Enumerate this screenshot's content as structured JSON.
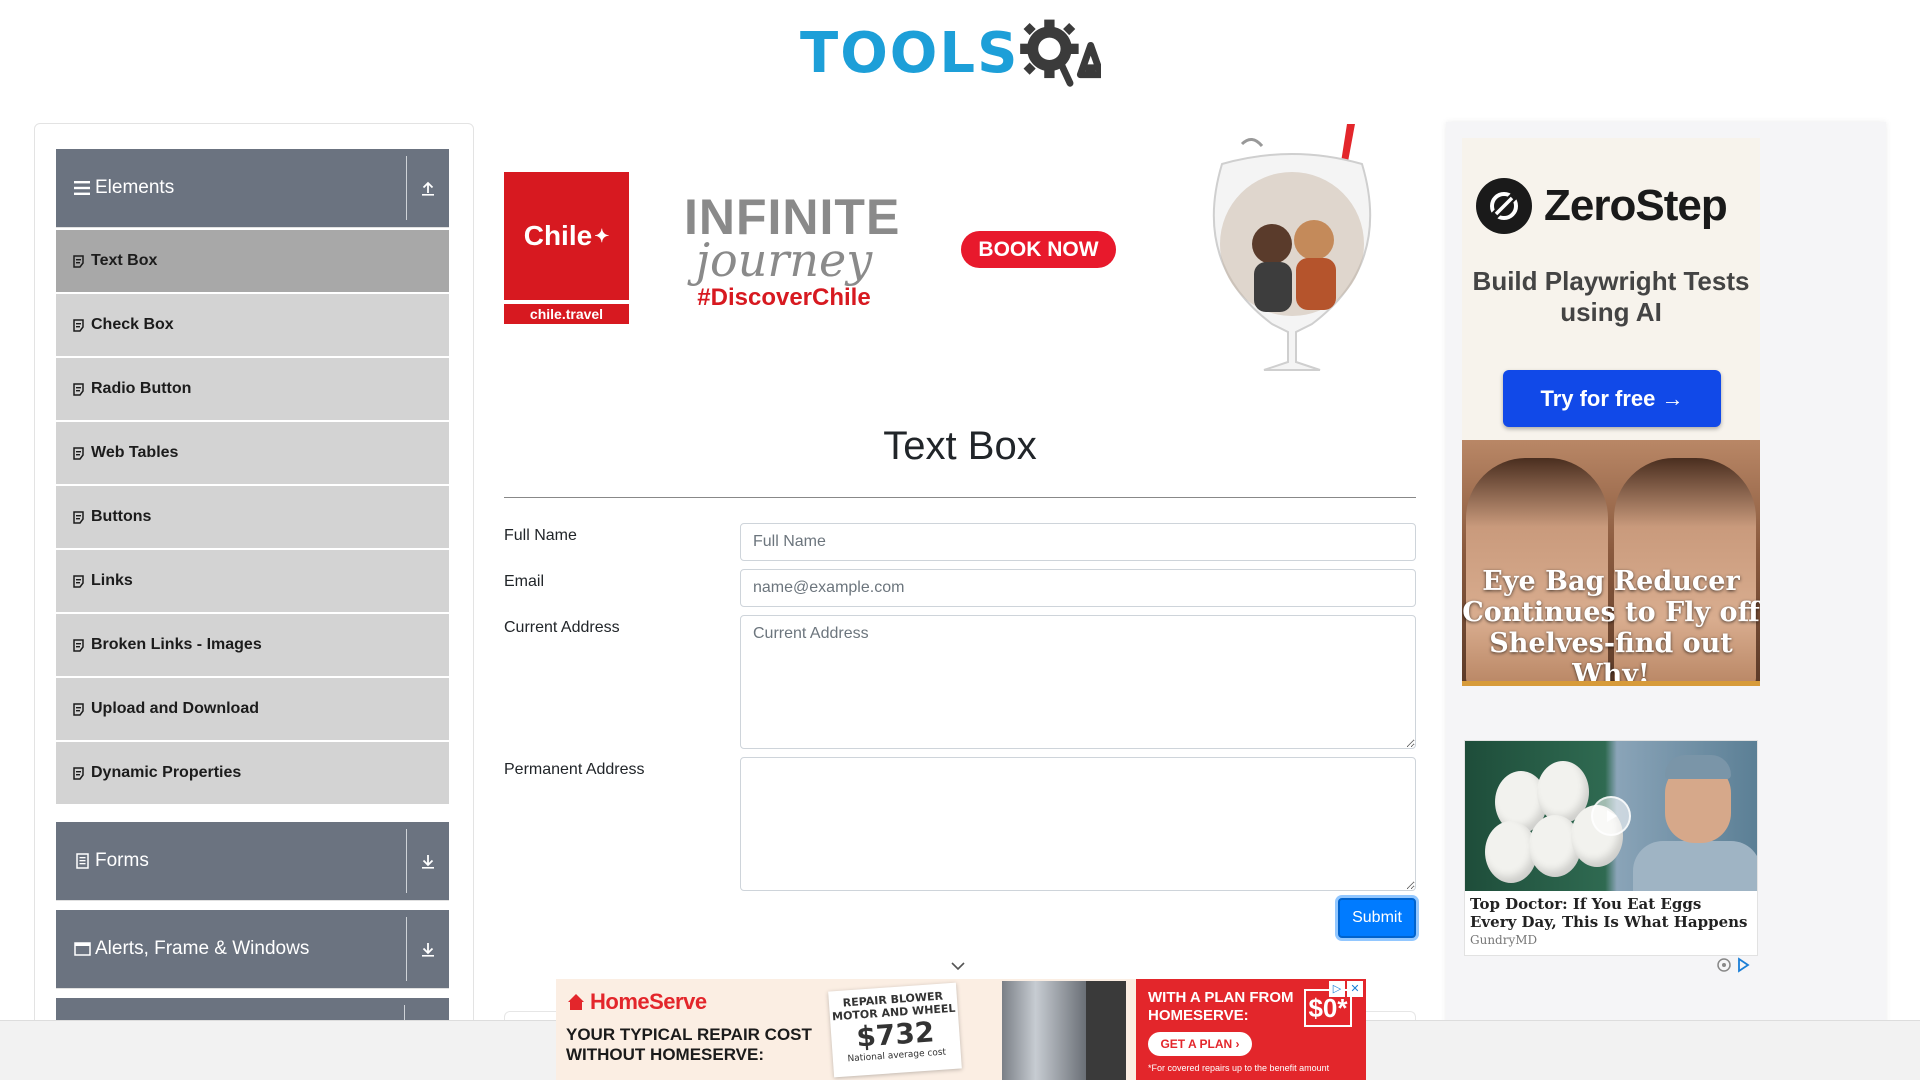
{
  "header": {
    "logo_text": "TOOLS",
    "logo_suffix": "QA"
  },
  "sidebar": {
    "groups": [
      {
        "title": "Elements",
        "icon": "hamburger-icon",
        "arrow": "upload-arrow-icon"
      },
      {
        "title": "Forms",
        "icon": "form-icon",
        "arrow": "download-arrow-icon"
      },
      {
        "title": "Alerts, Frame & Windows",
        "icon": "window-icon",
        "arrow": "download-arrow-icon"
      }
    ],
    "items": [
      {
        "label": "Text Box",
        "active": true
      },
      {
        "label": "Check Box"
      },
      {
        "label": "Radio Button"
      },
      {
        "label": "Web Tables"
      },
      {
        "label": "Buttons"
      },
      {
        "label": "Links"
      },
      {
        "label": "Broken Links - Images"
      },
      {
        "label": "Upload and Download"
      },
      {
        "label": "Dynamic Properties"
      }
    ]
  },
  "top_ad": {
    "chile_logo": "Chile",
    "chile_site": "chile.travel",
    "line1": "INFINITE",
    "line2": "journey",
    "hashtag": "#DiscoverChile",
    "cta": "BOOK NOW"
  },
  "main": {
    "title": "Text Box",
    "fields": {
      "full_name": {
        "label": "Full Name",
        "placeholder": "Full Name",
        "value": ""
      },
      "email": {
        "label": "Email",
        "placeholder": "name@example.com",
        "value": ""
      },
      "current_address": {
        "label": "Current Address",
        "placeholder": "Current Address",
        "value": ""
      },
      "permanent_address": {
        "label": "Permanent Address",
        "placeholder": "",
        "value": ""
      }
    },
    "submit_label": "Submit"
  },
  "right_ads": {
    "zerostep": {
      "name": "ZeroStep",
      "tagline": "Build Playwright Tests using AI",
      "cta": "Try for free →"
    },
    "eyebag": {
      "headline": "Eye Bag Reducer Continues to Fly off Shelves-find out Why!"
    },
    "eggs": {
      "title": "Top Doctor: If You Eat Eggs Every Day, This Is What Happens",
      "source": "GundryMD"
    }
  },
  "bottom_ad": {
    "brand": "HomeServe",
    "headline": "YOUR TYPICAL REPAIR COST WITHOUT HOMESERVE:",
    "card_title": "REPAIR BLOWER MOTOR AND WHEEL",
    "card_price": "$732",
    "card_note": "National average cost",
    "red_text": "WITH A PLAN FROM HOMESERVE:",
    "red_price": "$0*",
    "red_cta": "GET A PLAN ›",
    "red_note": "*For covered repairs up to the benefit amount"
  },
  "colors": {
    "brand_blue": "#1d9fd8",
    "sidebar_header": "#6b7380",
    "menu_item": "#d3d3d3",
    "menu_active": "#a8a8a8",
    "submit": "#007bff"
  }
}
